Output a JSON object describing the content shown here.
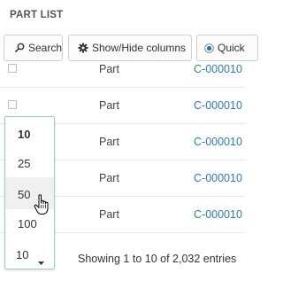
{
  "panel": {
    "title": "PART LIST"
  },
  "toolbar": {
    "search_label": "Search",
    "columns_label": "Show/Hide columns",
    "quick_label": "Quick"
  },
  "rows": [
    {
      "type": "Part",
      "number": "C-000010"
    },
    {
      "type": "Part",
      "number": "C-000010"
    },
    {
      "type": "Part",
      "number": "C-000010"
    },
    {
      "type": "Part",
      "number": "C-000010"
    },
    {
      "type": "Part",
      "number": "C-000010"
    }
  ],
  "page_size": {
    "options": [
      "10",
      "25",
      "50",
      "100"
    ],
    "selected": "10",
    "hovered": "50",
    "current_value": "10"
  },
  "footer": {
    "info": "Showing 1 to 10 of 2,032 entries"
  },
  "colors": {
    "accent": "#2e7cc0",
    "select_border": "#97cdd9",
    "hover_bg": "#f0f0f0"
  }
}
